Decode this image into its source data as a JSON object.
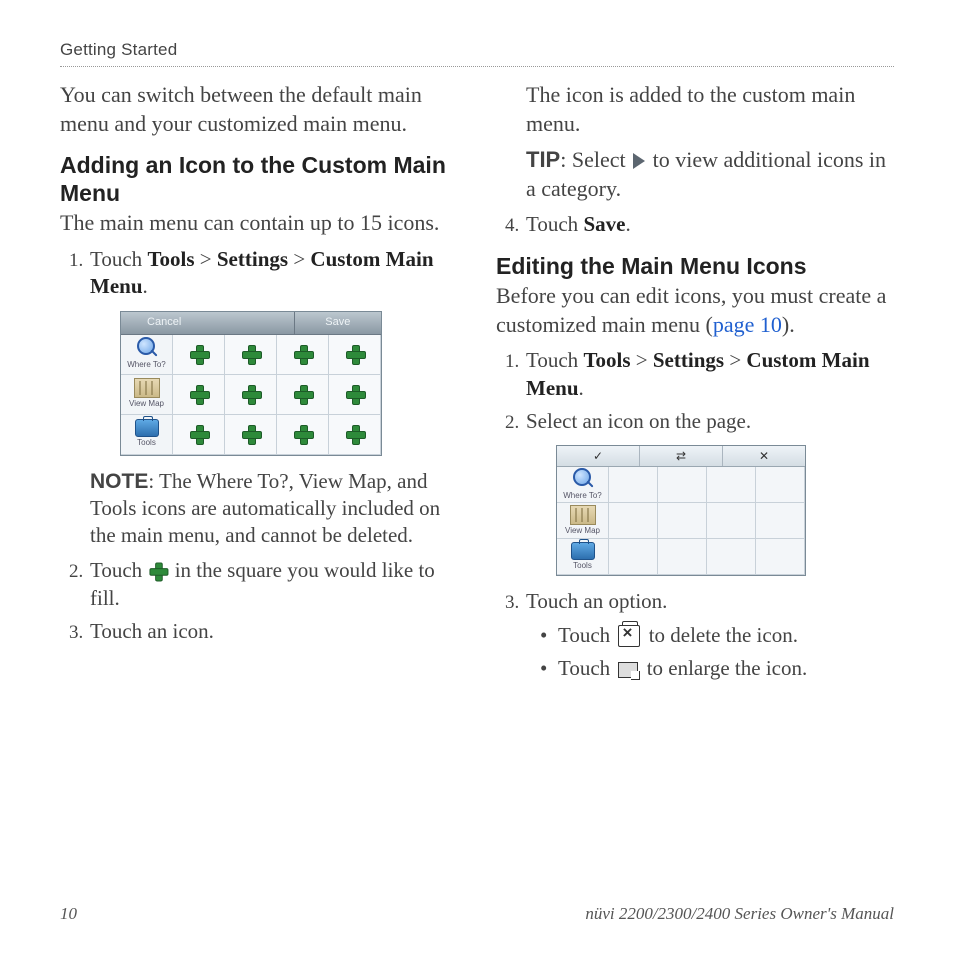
{
  "running_head": "Getting Started",
  "page_number": "10",
  "footer_right": "nüvi 2200/2300/2400 Series Owner's Manual",
  "left": {
    "intro": "You can switch between the default main menu and your customized main menu.",
    "h_adding": "Adding an Icon to the Custom Main Menu",
    "adding_lead": "The main menu can contain up to 15 icons.",
    "step1_a": "Touch ",
    "step1_tools": "Tools",
    "step1_gt1": " > ",
    "step1_settings": "Settings",
    "step1_gt2": " > ",
    "step1_cmm": "Custom Main Menu",
    "step1_end": ".",
    "note_label": "NOTE",
    "note_text": ": The Where To?, View Map, and Tools icons are automatically included on the main menu, and cannot be deleted.",
    "step2_a": "Touch ",
    "step2_b": " in the square you would like to fill.",
    "step3": "Touch an icon.",
    "dev_cancel": "Cancel",
    "dev_save": "Save",
    "side_where": "Where To?",
    "side_view": "View Map",
    "side_tools": "Tools"
  },
  "right": {
    "added": "The icon is added to the custom main menu.",
    "tip_label": "TIP",
    "tip_a": ": Select ",
    "tip_b": " to view additional icons in a category.",
    "step4_a": "Touch ",
    "step4_save": "Save",
    "step4_end": ".",
    "h_editing": "Editing the Main Menu Icons",
    "editing_lead_a": "Before you can edit icons, you must create a customized main menu (",
    "editing_link": "page 10",
    "editing_lead_b": ").",
    "e1_a": "Touch ",
    "e1_tools": "Tools",
    "e1_gt1": " > ",
    "e1_settings": "Settings",
    "e1_gt2": " > ",
    "e1_cmm": "Custom Main Menu",
    "e1_end": ".",
    "e2": "Select an icon on the page.",
    "e3": "Touch an option.",
    "opt_del_a": "Touch ",
    "opt_del_b": " to delete the icon.",
    "opt_enl_a": "Touch ",
    "opt_enl_b": " to enlarge the icon.",
    "tb_check": "✓",
    "tb_move": "⇄",
    "tb_x": "✕"
  }
}
